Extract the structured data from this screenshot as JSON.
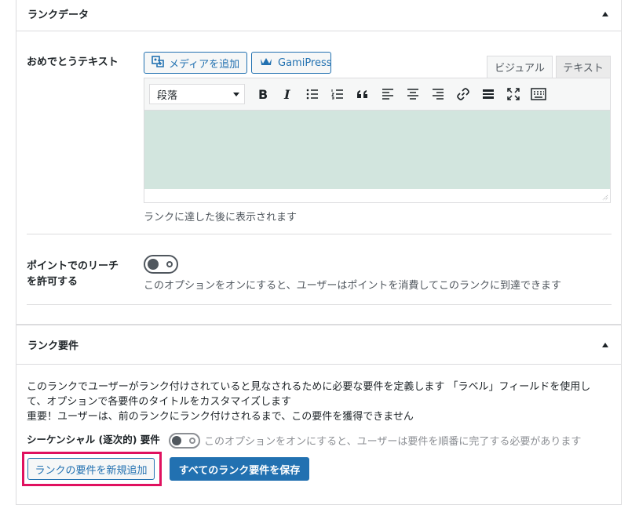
{
  "rank_data": {
    "title": "ランクデータ",
    "congrats_label": "おめでとうテキスト",
    "add_media_button": "メディアを追加",
    "gamipress_button": "GamiPress",
    "tab_visual": "ビジュアル",
    "tab_text": "テキスト",
    "format_select": "段落",
    "help_text": "ランクに達した後に表示されます",
    "points_label_line1": "ポイントでのリーチ",
    "points_label_line2": "を許可する",
    "points_help": "このオプションをオンにすると、ユーザーはポイントを消費してこのランクに到達できます",
    "points_toggle_on": false
  },
  "rank_requirements": {
    "title": "ランク要件",
    "description_line1": "このランクでユーザーがランク付けされていると見なされるために必要な要件を定義します 「ラベル」フィールドを使用し",
    "description_line2": "て、オプションで各要件のタイトルをカスタマイズします",
    "important_note": "重要！ユーザーは、前のランクにランク付けされるまで、この要件を獲得できません",
    "sequential_label": "シーケンシャル (逐次的) 要件",
    "sequential_help": "このオプションをオンにすると、ユーザーは要件を順番に完了する必要があります",
    "sequential_toggle_on": false,
    "add_button": "ランクの要件を新規追加",
    "save_button": "すべてのランク要件を保存"
  },
  "colors": {
    "accent": "#2271b1",
    "highlight_box": "#e0115f",
    "editor_body": "#d2e5de"
  }
}
